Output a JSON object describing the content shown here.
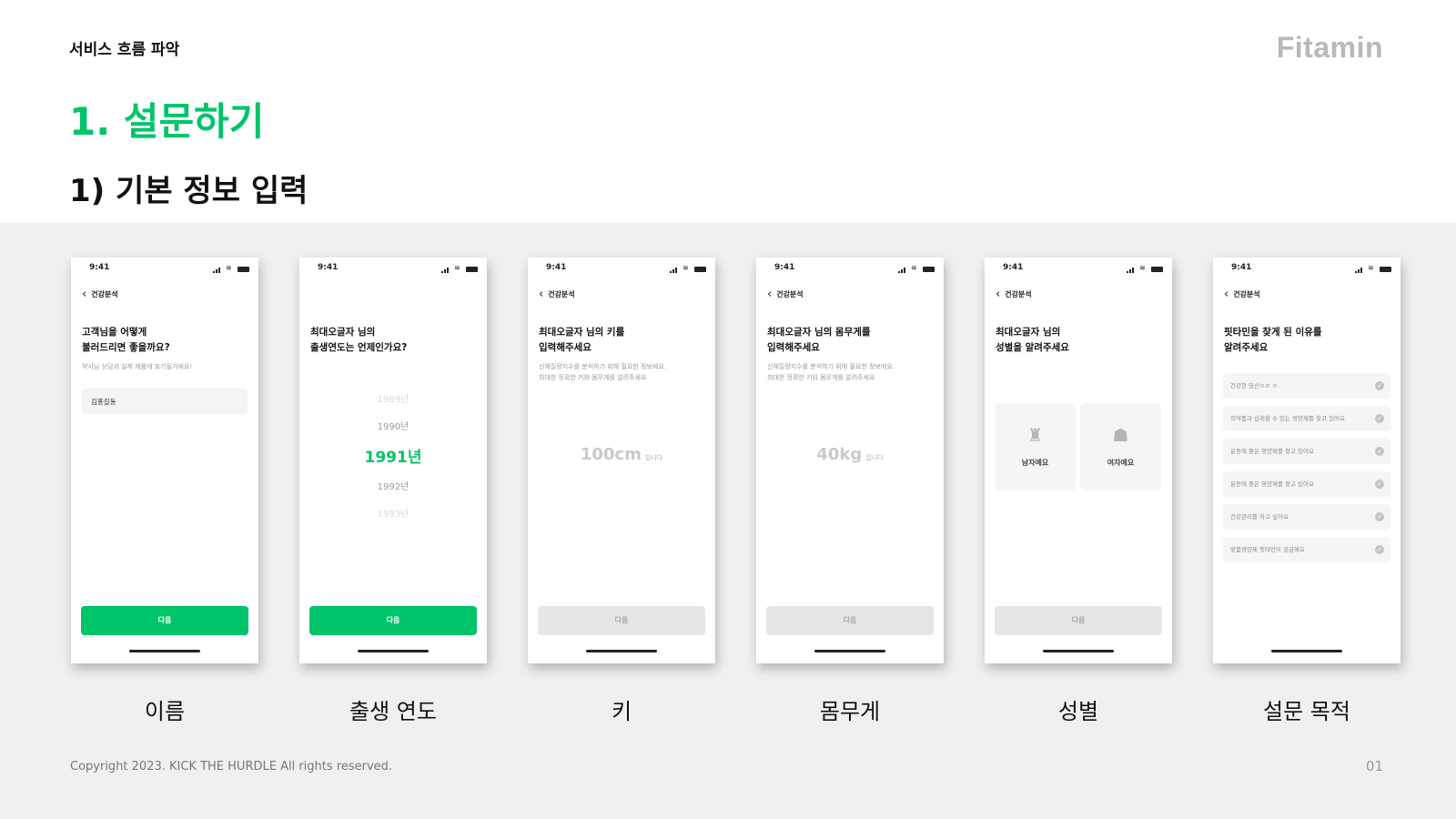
{
  "header": {
    "breadcrumb": "서비스 흐름 파악",
    "brand": "Fitamin",
    "title": "1. 설문하기",
    "subtitle": "1) 기본 정보 입력"
  },
  "phone_common": {
    "time": "9:41",
    "nav_label": "건강분석"
  },
  "screens": {
    "name": {
      "question": [
        "고객님을 어떻게",
        "불러드리면 좋을까요?"
      ],
      "hint": "약사님 상담과 실제 제품에 표기될거에요!",
      "input_value": "김홍길동",
      "button": "다음",
      "caption": "이름"
    },
    "birth": {
      "question": [
        "최대오글자 님의",
        "출생연도는 언제인가요?"
      ],
      "years": [
        "1989년",
        "1990년",
        "1991년",
        "1992년",
        "1993년"
      ],
      "selected": "1991년",
      "button": "다음",
      "caption": "출생 연도"
    },
    "height": {
      "question": [
        "최대오글자 님의 키를",
        "입력해주세요"
      ],
      "hint": [
        "신체질량지수를 분석하기 위해 필요한 정보에요.",
        "최대한 정확한 키와 몸무게를 알려주세요"
      ],
      "value": "100cm",
      "unit": "입니다",
      "button": "다음",
      "caption": "키"
    },
    "weight": {
      "question": [
        "최대오글자 님의 몸무게를",
        "입력해주세요"
      ],
      "hint": [
        "신체질량지수를 분석하기 위해 필요한 정보에요.",
        "최대한 정확한 키와 몸무게를 알려주세요"
      ],
      "value": "40kg",
      "unit": "입니다",
      "button": "다음",
      "caption": "몸무게"
    },
    "gender": {
      "question": [
        "최대오글자 님의",
        "성별을 알려주세요"
      ],
      "options": [
        "남자예요",
        "여자예요"
      ],
      "button": "다음",
      "caption": "성별"
    },
    "purpose": {
      "question": [
        "핏타민을 찾게 된 이유를",
        "알려주세요"
      ],
      "options": [
        "건강한 임신ㅇㄹ ㅇ",
        "의약품과 섭취할 수 있는 영양제를 찾고 있어요",
        "운동에 좋은 영양제를 찾고 있어요",
        "운동에 좋은 영양제를 찾고 있어요",
        "건강관리를 하고 싶어요",
        "맞춤영양제 핏타민이 궁금해요"
      ],
      "caption": "설문 목적"
    }
  },
  "footer": {
    "copyright": "Copyright 2023. KICK THE HURDLE All rights reserved.",
    "page": "01"
  },
  "colors": {
    "accent": "#00c46a",
    "stage_bg": "#f0f0f0",
    "disabled_button": "#e6e6e6"
  }
}
